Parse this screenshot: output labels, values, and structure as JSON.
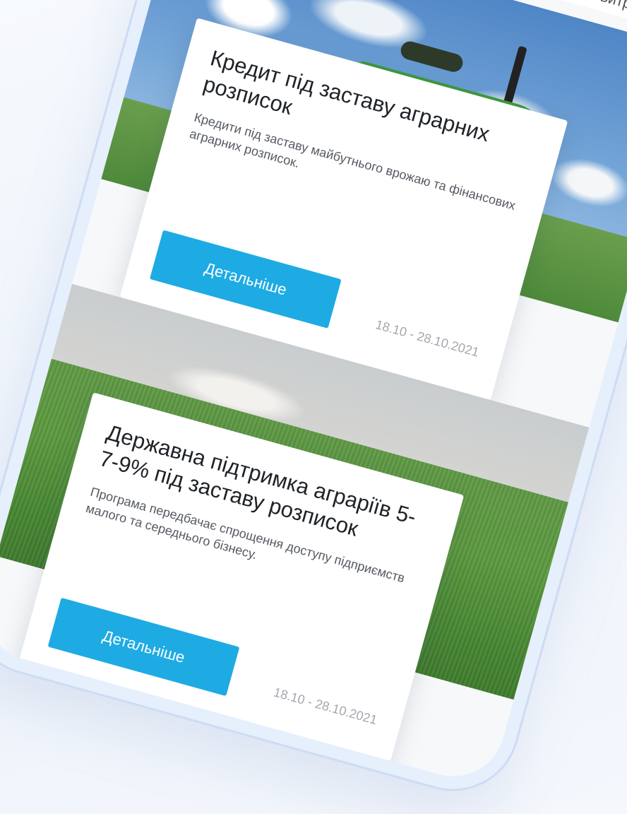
{
  "top_snippet": "их витратах",
  "cards": [
    {
      "title": "Кредит під заставу аграрних розписок",
      "description": "Кредити під заставу майбутнього врожаю та фінансових аграрних розписок.",
      "button_label": "Детальніше",
      "date_range": "18.10 - 28.10.2021"
    },
    {
      "title": "Державна підтримка аграріїв 5-7-9% під заставу розписок",
      "description": "Програма передбачає спрощення доступу підприємств малого та середнього бізнесу.",
      "button_label": "Детальніше",
      "date_range": "18.10 - 28.10.2021"
    }
  ],
  "colors": {
    "accent": "#1eabe3",
    "phone_frame": "#e6effc",
    "background": "#f4f7fc"
  }
}
